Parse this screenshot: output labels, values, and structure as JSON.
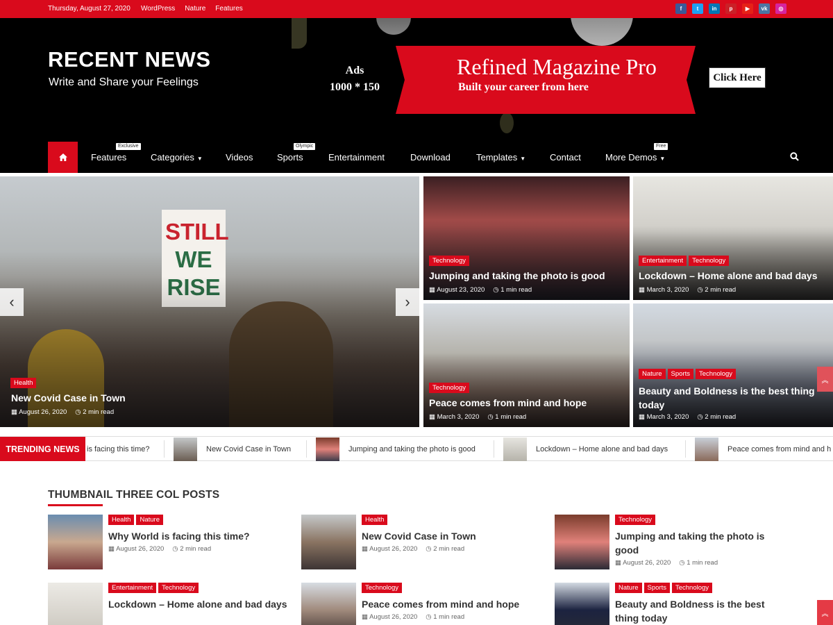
{
  "topbar": {
    "date": "Thursday, August 27, 2020",
    "links": [
      "WordPress",
      "Nature",
      "Features"
    ],
    "social": [
      {
        "icon": "facebook-icon",
        "glyph": "f",
        "color": "#3b5998"
      },
      {
        "icon": "twitter-icon",
        "glyph": "t",
        "color": "#1da1f2"
      },
      {
        "icon": "linkedin-icon",
        "glyph": "in",
        "color": "#0077b5"
      },
      {
        "icon": "pinterest-icon",
        "glyph": "p",
        "color": "#cb2027"
      },
      {
        "icon": "youtube-icon",
        "glyph": "▶",
        "color": "#e62117"
      },
      {
        "icon": "vk-icon",
        "glyph": "vk",
        "color": "#4c75a3"
      },
      {
        "icon": "instagram-icon",
        "glyph": "◎",
        "color": "#d6249f"
      }
    ]
  },
  "header": {
    "title": "RECENT NEWS",
    "tagline": "Write and Share your Feelings",
    "ad": {
      "line1": "Ads",
      "line2": "1000 * 150",
      "title": "Refined Magazine Pro",
      "subtitle": "Built your career from here",
      "button": "Click Here"
    }
  },
  "nav": {
    "items": [
      {
        "label": "Features",
        "badge": "Exclusive",
        "caret": false
      },
      {
        "label": "Categories",
        "badge": "",
        "caret": true
      },
      {
        "label": "Videos",
        "badge": "",
        "caret": false
      },
      {
        "label": "Sports",
        "badge": "Olympic",
        "caret": false
      },
      {
        "label": "Entertainment",
        "badge": "",
        "caret": false
      },
      {
        "label": "Download",
        "badge": "",
        "caret": false
      },
      {
        "label": "Templates",
        "badge": "",
        "caret": true
      },
      {
        "label": "Contact",
        "badge": "",
        "caret": false
      },
      {
        "label": "More Demos",
        "badge": "Free",
        "caret": true
      }
    ]
  },
  "hero": {
    "main": {
      "categories": [
        "Health"
      ],
      "title": "New Covid Case in Town",
      "date": "August 26, 2020",
      "read": "2 min read"
    },
    "tiles": [
      {
        "categories": [
          "Technology"
        ],
        "title": "Jumping and taking the photo is good",
        "date": "August 23, 2020",
        "read": "1 min read"
      },
      {
        "categories": [
          "Entertainment",
          "Technology"
        ],
        "title": "Lockdown – Home alone and bad days",
        "date": "March 3, 2020",
        "read": "2 min read"
      },
      {
        "categories": [
          "Technology"
        ],
        "title": "Peace comes from mind and hope",
        "date": "March 3, 2020",
        "read": "1 min read"
      },
      {
        "categories": [
          "Nature",
          "Sports",
          "Technology"
        ],
        "title": "Beauty and Boldness is the best thing today",
        "date": "March 3, 2020",
        "read": "2 min read"
      }
    ]
  },
  "trending": {
    "label": "TRENDING NEWS",
    "first": "is facing this time?",
    "items": [
      "New Covid Case in Town",
      "Jumping and taking the photo is good",
      "Lockdown – Home alone and bad days",
      "Peace comes from mind and h"
    ]
  },
  "section": {
    "title": "THUMBNAIL THREE COL POSTS",
    "posts": [
      {
        "categories": [
          "Health",
          "Nature"
        ],
        "title": "Why World is facing this time?",
        "date": "August 26, 2020",
        "read": "2 min read"
      },
      {
        "categories": [
          "Health"
        ],
        "title": "New Covid Case in Town",
        "date": "August 26, 2020",
        "read": "2 min read"
      },
      {
        "categories": [
          "Technology"
        ],
        "title": "Jumping and taking the photo is good",
        "date": "August 26, 2020",
        "read": "1 min read"
      },
      {
        "categories": [
          "Entertainment",
          "Technology"
        ],
        "title": "Lockdown – Home alone and bad days",
        "date": "",
        "read": ""
      },
      {
        "categories": [
          "Technology"
        ],
        "title": "Peace comes from mind and hope",
        "date": "August 26, 2020",
        "read": "1 min read"
      },
      {
        "categories": [
          "Nature",
          "Sports",
          "Technology"
        ],
        "title": "Beauty and Boldness is the best thing today",
        "date": "",
        "read": ""
      }
    ]
  },
  "colors": {
    "accent": "#d90a1c",
    "header_bg": "#000000"
  }
}
